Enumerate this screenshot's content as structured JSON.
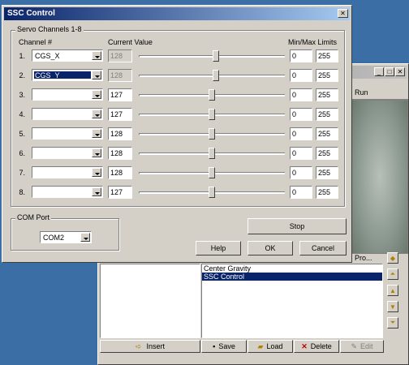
{
  "dialog": {
    "title": "SSC Control",
    "close_glyph": "✕",
    "group_title": "Servo Channels 1-8",
    "col_channel": "Channel #",
    "col_current": "Current Value",
    "col_minmax": "Min/Max Limits",
    "rows": [
      {
        "num": "1.",
        "channel": "CGS_X",
        "value": "128",
        "min": "0",
        "max": "255",
        "level": 0.53,
        "disabled": true,
        "selected": false
      },
      {
        "num": "2.",
        "channel": "CGS_Y",
        "value": "128",
        "min": "0",
        "max": "255",
        "level": 0.53,
        "disabled": true,
        "selected": true
      },
      {
        "num": "3.",
        "channel": "",
        "value": "127",
        "min": "0",
        "max": "255",
        "level": 0.5,
        "disabled": false,
        "selected": false
      },
      {
        "num": "4.",
        "channel": "",
        "value": "127",
        "min": "0",
        "max": "255",
        "level": 0.5,
        "disabled": false,
        "selected": false
      },
      {
        "num": "5.",
        "channel": "",
        "value": "128",
        "min": "0",
        "max": "255",
        "level": 0.5,
        "disabled": false,
        "selected": false
      },
      {
        "num": "6.",
        "channel": "",
        "value": "128",
        "min": "0",
        "max": "255",
        "level": 0.5,
        "disabled": false,
        "selected": false
      },
      {
        "num": "7.",
        "channel": "",
        "value": "128",
        "min": "0",
        "max": "255",
        "level": 0.5,
        "disabled": false,
        "selected": false
      },
      {
        "num": "8.",
        "channel": "",
        "value": "127",
        "min": "0",
        "max": "255",
        "level": 0.5,
        "disabled": false,
        "selected": false
      }
    ],
    "com_group": "COM Port",
    "com_value": "COM2",
    "stop_label": "Stop",
    "help_label": "Help",
    "ok_label": "OK",
    "cancel_label": "Cancel"
  },
  "behind": {
    "image_header": "Run",
    "list_items": [
      "Center Gravity",
      "SSC Control"
    ],
    "selected_index": 1,
    "buttons": {
      "insert": "Insert",
      "save": "Save",
      "load": "Load",
      "delete": "Delete",
      "edit": "Edit"
    },
    "partial_label": "Pro..."
  }
}
